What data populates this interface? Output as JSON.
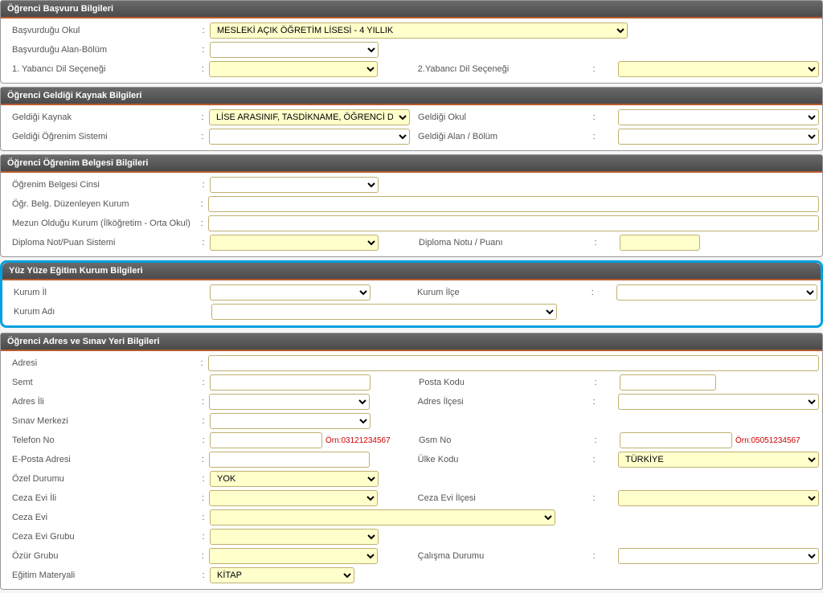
{
  "sections": {
    "basvuru": {
      "title": "Öğrenci Başvuru Bilgileri"
    },
    "kaynak": {
      "title": "Öğrenci Geldiği Kaynak Bilgileri"
    },
    "belge": {
      "title": "Öğrenci Öğrenim Belgesi Bilgileri"
    },
    "yuzyuze": {
      "title": "Yüz Yüze Eğitim Kurum Bilgileri"
    },
    "adres": {
      "title": "Öğrenci Adres ve Sınav Yeri Bilgileri"
    }
  },
  "basvuru": {
    "okul_label": "Başvurduğu Okul",
    "okul_value": "MESLEKİ AÇIK ÖĞRETİM LİSESİ - 4 YILLIK",
    "alan_label": "Başvurduğu Alan-Bölüm",
    "alan_value": "",
    "dil1_label": "1. Yabancı Dil Seçeneği",
    "dil1_value": "",
    "dil2_label": "2.Yabancı Dil Seçeneği",
    "dil2_value": ""
  },
  "kaynak": {
    "geldigi_kaynak_label": "Geldiği Kaynak",
    "geldigi_kaynak_value": "LİSE ARASINIF, TASDİKNAME, ÖĞRENCİ DURUM BELGESİ",
    "geldigi_okul_label": "Geldiği Okul",
    "geldigi_okul_value": "",
    "geldigi_sistem_label": "Geldiği Öğrenim Sistemi",
    "geldigi_sistem_value": "",
    "geldigi_alan_label": "Geldiği Alan / Bölüm",
    "geldigi_alan_value": ""
  },
  "belge": {
    "cinsi_label": "Öğrenim Belgesi Cinsi",
    "duzenleyen_label": "Öğr. Belg. Düzenleyen Kurum",
    "mezun_label": "Mezun Olduğu Kurum (İlköğretim - Orta Okul)",
    "diploma_sistem_label": "Diploma Not/Puan Sistemi",
    "diploma_notu_label": "Diploma Notu / Puanı"
  },
  "yuzyuze": {
    "il_label": "Kurum İl",
    "ilce_label": "Kurum İlçe",
    "ad_label": "Kurum Adı"
  },
  "adres": {
    "adres_label": "Adresi",
    "semt_label": "Semt",
    "posta_label": "Posta Kodu",
    "il_label": "Adres İli",
    "ilce_label": "Adres İlçesi",
    "sinav_merkezi_label": "Sınav Merkezi",
    "telefon_label": "Telefon No",
    "telefon_hint": "Örn:03121234567",
    "gsm_label": "Gsm No",
    "gsm_hint": "Örn:05051234567",
    "eposta_label": "E-Posta Adresi",
    "ulke_label": "Ülke Kodu",
    "ulke_value": "TÜRKİYE",
    "ozel_label": "Özel Durumu",
    "ozel_value": "YOK",
    "ceza_il_label": "Ceza Evi İli",
    "ceza_ilce_label": "Ceza Evi İlçesi",
    "ceza_evi_label": "Ceza Evi",
    "ceza_grubu_label": "Ceza Evi Grubu",
    "ozur_label": "Özür Grubu",
    "calisma_label": "Çalışma Durumu",
    "materyal_label": "Eğitim Materyali",
    "materyal_value": "KİTAP"
  }
}
